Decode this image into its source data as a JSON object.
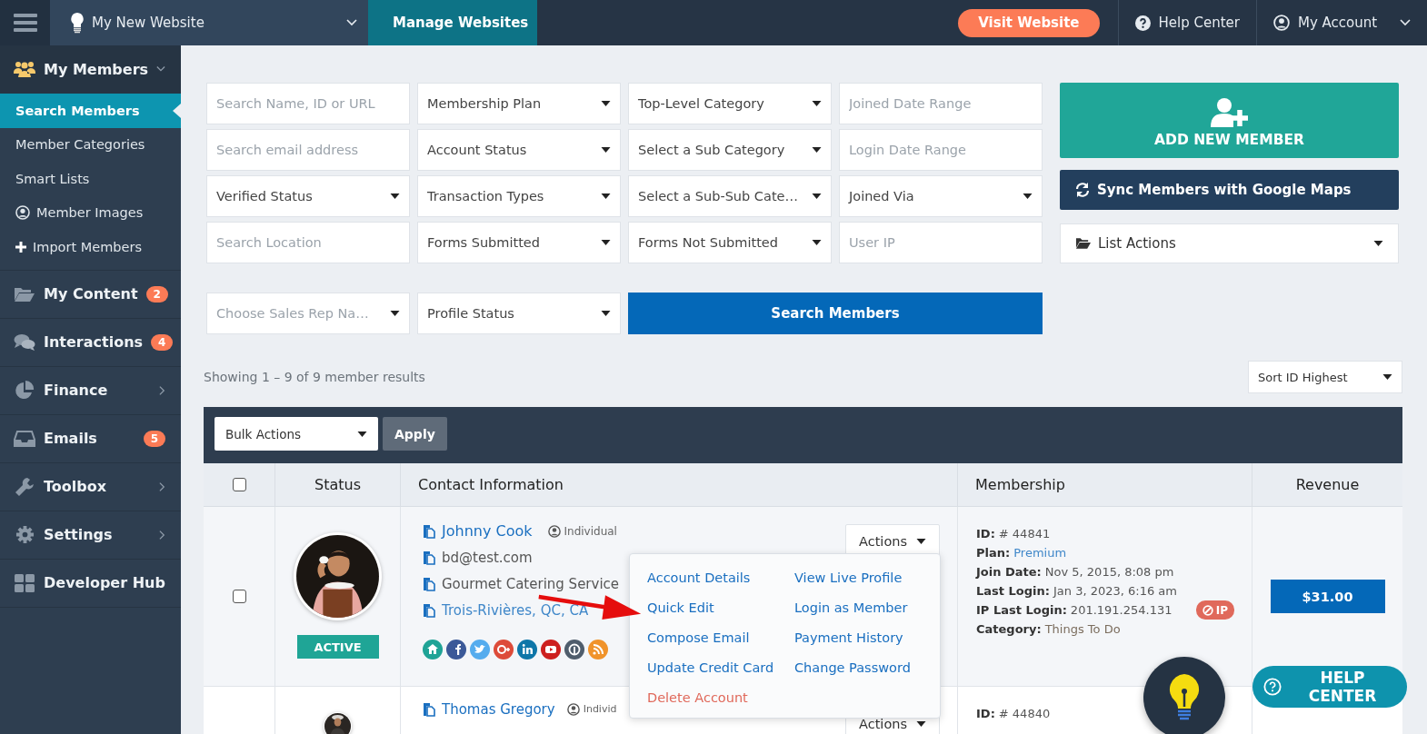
{
  "top_bar": {
    "site_name": "My New Website",
    "manage_button": "Manage Websites",
    "visit_button": "Visit Website",
    "help_link": "Help Center",
    "account_menu": "My Account"
  },
  "sidebar": {
    "items": [
      {
        "label": "My Members",
        "kind": "menu",
        "expanded": true,
        "children": [
          {
            "label": "Search Members",
            "selected": true
          },
          {
            "label": "Member Categories",
            "selected": false
          },
          {
            "label": "Smart Lists",
            "selected": false
          },
          {
            "label": "Member Images",
            "selected": false
          },
          {
            "label": "Import Members",
            "selected": false
          }
        ]
      },
      {
        "label": "My Content",
        "kind": "badge",
        "badge": "2"
      },
      {
        "label": "Interactions",
        "kind": "badge",
        "badge": "4"
      },
      {
        "label": "Finance",
        "kind": "menu",
        "expanded": false
      },
      {
        "label": "Emails",
        "kind": "badge",
        "badge": "5"
      },
      {
        "label": "Toolbox",
        "kind": "menu",
        "expanded": false
      },
      {
        "label": "Settings",
        "kind": "menu",
        "expanded": false
      },
      {
        "label": "Developer Hub",
        "kind": "link"
      }
    ]
  },
  "filters": [
    {
      "kind": "input",
      "placeholder": "Search Name, ID or URL"
    },
    {
      "kind": "select",
      "value": "Membership Plan"
    },
    {
      "kind": "select",
      "value": "Top-Level Category"
    },
    {
      "kind": "input",
      "placeholder": "Joined Date Range"
    },
    {
      "kind": "input",
      "placeholder": "Search email address"
    },
    {
      "kind": "select",
      "value": "Account Status"
    },
    {
      "kind": "select",
      "value": "Select a Sub Category"
    },
    {
      "kind": "input",
      "placeholder": "Login Date Range"
    },
    {
      "kind": "select",
      "value": "Verified Status"
    },
    {
      "kind": "select",
      "value": "Transaction Types"
    },
    {
      "kind": "select",
      "value": "Select a Sub-Sub Cate…"
    },
    {
      "kind": "select",
      "value": "Joined Via"
    },
    {
      "kind": "input",
      "placeholder": "Search Location"
    },
    {
      "kind": "select",
      "value": "Forms Submitted"
    },
    {
      "kind": "select",
      "value": "Forms Not Submitted"
    },
    {
      "kind": "input",
      "placeholder": "User IP"
    },
    {
      "kind": "select",
      "placeholder": "Choose Sales Rep Na…"
    },
    {
      "kind": "select",
      "value": "Profile Status"
    },
    {
      "kind": "button",
      "label": "Search Members"
    }
  ],
  "side_actions": {
    "add_button": "ADD NEW MEMBER",
    "sync_button": "Sync Members with Google Maps",
    "list_actions": "List Actions"
  },
  "results": {
    "summary": "Showing 1 – 9 of 9 member results",
    "sort": "Sort ID Highest"
  },
  "table": {
    "bulk_actions": "Bulk Actions",
    "apply_button": "Apply",
    "select_all_checked": false,
    "columns": [
      "Status",
      "Contact Information",
      "Membership",
      "Revenue"
    ],
    "rows": [
      {
        "checked": false,
        "status": "ACTIVE",
        "name": "Johnny Cook",
        "type": "Individual",
        "email": "bd@test.com",
        "company": "Gourmet Catering Service",
        "location": "Trois-Rivières, QC, CA",
        "actions": "Actions",
        "membership": [
          {
            "label": "ID:",
            "value": "# 44841",
            "kind": "plain"
          },
          {
            "label": "Plan:",
            "value": "Premium",
            "kind": "link"
          },
          {
            "label": "Join Date:",
            "value": "Nov 5, 2015, 8:08 pm",
            "kind": "plain"
          },
          {
            "label": "Last Login:",
            "value": "Jan 3, 2023, 6:16 am",
            "kind": "plain"
          },
          {
            "label": "IP Last Login:",
            "value": "201.191.254.131",
            "kind": "plain",
            "badge": "IP"
          },
          {
            "label": "Category:",
            "value": "Things To Do",
            "kind": "muted"
          }
        ],
        "revenue": "$31.00"
      },
      {
        "name": "Thomas Gregory",
        "type": "Individ",
        "actions": "Actions",
        "membership": [
          {
            "label": "ID:",
            "value": "# 44840",
            "kind": "plain"
          }
        ]
      }
    ]
  },
  "actions_menu": {
    "items": [
      {
        "label": "Account Details",
        "kind": "link"
      },
      {
        "label": "View Live Profile",
        "kind": "link"
      },
      {
        "label": "Quick Edit",
        "kind": "link"
      },
      {
        "label": "Login as Member",
        "kind": "link"
      },
      {
        "label": "Compose Email",
        "kind": "link"
      },
      {
        "label": "Payment History",
        "kind": "link"
      },
      {
        "label": "Update Credit Card",
        "kind": "link"
      },
      {
        "label": "Change Password",
        "kind": "link"
      },
      {
        "label": "Delete Account",
        "kind": "danger"
      }
    ]
  },
  "help_widget": "HELP CENTER"
}
